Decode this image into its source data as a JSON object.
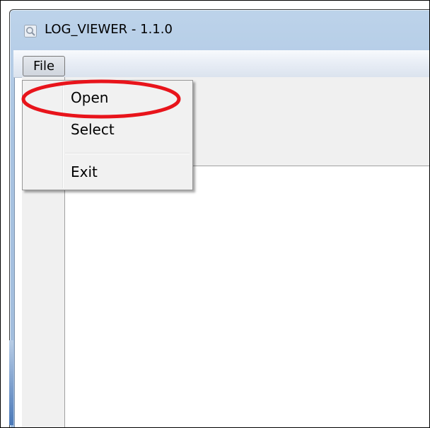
{
  "window": {
    "title": "LOG_VIEWER - 1.1.0",
    "app_icon": "magnifier-icon"
  },
  "menubar": {
    "file_label": "File"
  },
  "file_menu": {
    "items": [
      {
        "label": "Open",
        "highlighted": true
      },
      {
        "label": "Select"
      },
      {
        "label": "Exit"
      }
    ]
  },
  "colors": {
    "highlight_ellipse": "#e8141b",
    "titlebar": "#a9c4e2"
  }
}
